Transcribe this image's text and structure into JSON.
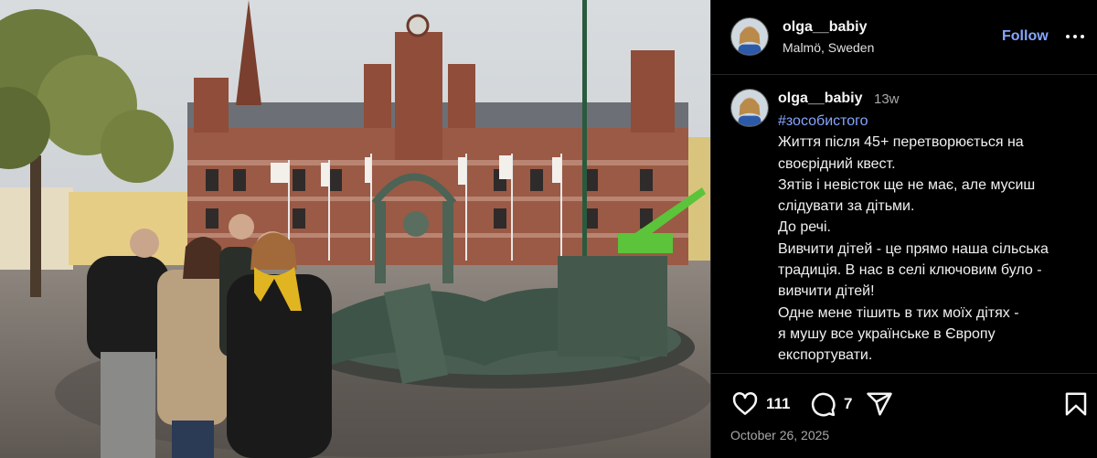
{
  "photo": {
    "alt_icon": "photo"
  },
  "header": {
    "username": "olga__babiy",
    "location": "Malmö, Sweden",
    "follow_label": "Follow",
    "more_icon": "more-horizontal-icon"
  },
  "caption": {
    "username": "olga__babiy",
    "time_ago": "13w",
    "hashtag": "#зособистого",
    "lines": [
      "Життя після 45+  перетворюється на",
      "своєрідний квест.",
      "Зятів і невісток ще не має, але мусиш",
      "слідувати за дітьми.",
      "До речі.",
      "Вивчити дітей - це прямо наша сільська",
      "традиція. В нас в селі ключовим було -",
      "вивчити дітей!",
      "Одне мене тішить в тих моїх дітях -",
      "я мушу все українське  в Європу",
      "експортувати."
    ]
  },
  "actions": {
    "likes": "111",
    "comments": "7",
    "date": "October 26, 2025"
  },
  "colors": {
    "accent": "#85a6ff",
    "background": "#000000",
    "muted": "#a8a8a8"
  }
}
